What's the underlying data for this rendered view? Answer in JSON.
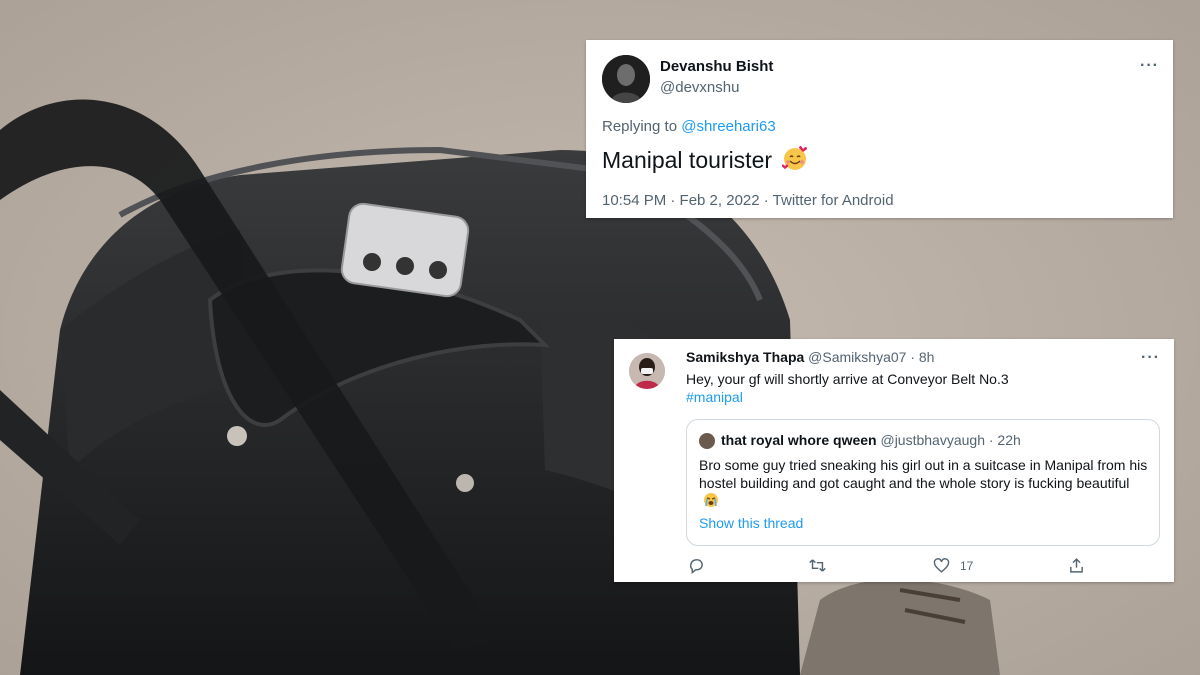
{
  "tweet1": {
    "display_name": "Devanshu Bisht",
    "handle": "@devxnshu",
    "replying_prefix": "Replying to",
    "replying_handle": "@shreehari63",
    "text": "Manipal tourister",
    "meta": "10:54 PM · Feb 2, 2022 · Twitter for Android",
    "more": "···",
    "emoji": "smiling-face-with-hearts"
  },
  "tweet2": {
    "display_name": "Samikshya Thapa",
    "handle_time": "@Samikshya07 · 8h",
    "text": "Hey, your gf will shortly arrive at Conveyor Belt No.3",
    "hashtag": "#manipal",
    "more": "···",
    "quote": {
      "display_name": "that royal whore qween",
      "handle_time": "@justbhavyaugh · 22h",
      "text": "Bro some guy tried sneaking his girl out in a suitcase in Manipal from his hostel building and got caught and the whole story is fucking beautiful",
      "emoji": "loudly-crying-face",
      "show_thread": "Show this thread"
    },
    "actions": {
      "reply_count": "",
      "retweet_count": "",
      "like_count": "17",
      "share_count": ""
    }
  },
  "colors": {
    "link": "#1d9bf0",
    "secondary_text": "#536471",
    "primary_text": "#0f1419",
    "border": "#cfd9de"
  }
}
